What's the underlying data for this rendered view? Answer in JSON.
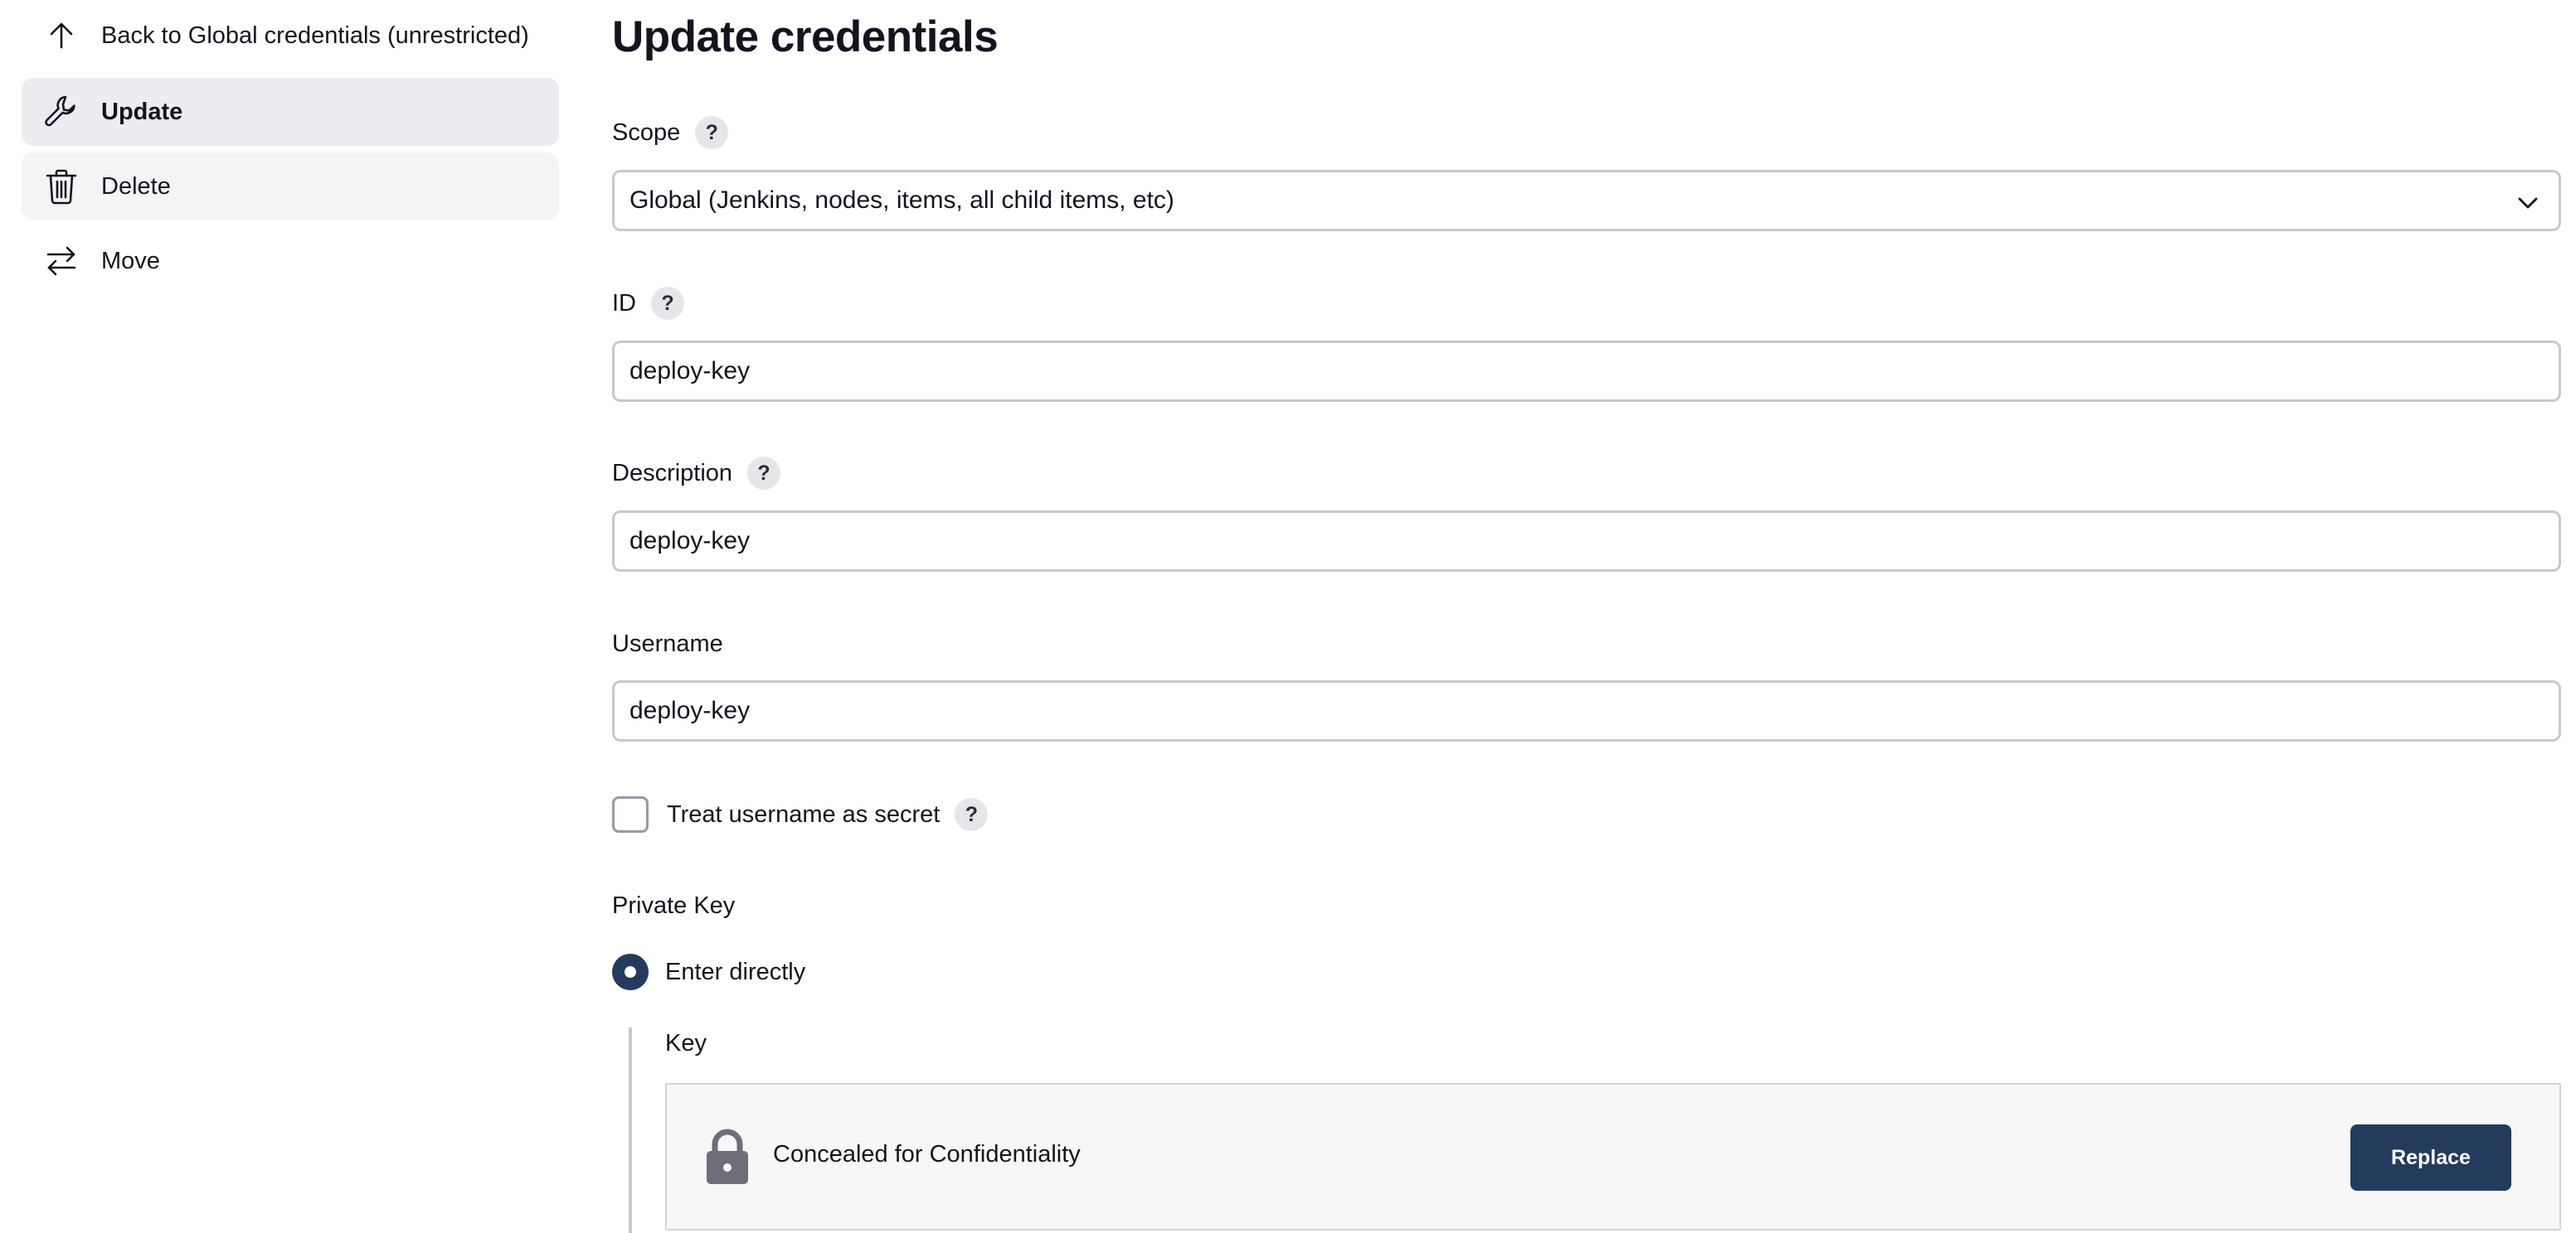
{
  "sidebar": {
    "items": [
      {
        "label": "Back to Global credentials (unrestricted)",
        "icon": "arrow-up-icon"
      },
      {
        "label": "Update",
        "icon": "wrench-icon"
      },
      {
        "label": "Delete",
        "icon": "trash-icon"
      },
      {
        "label": "Move",
        "icon": "swap-arrows-icon"
      }
    ]
  },
  "page": {
    "title": "Update credentials"
  },
  "form": {
    "scope": {
      "label": "Scope",
      "help": "?",
      "value": "Global (Jenkins, nodes, items, all child items, etc)"
    },
    "id": {
      "label": "ID",
      "help": "?",
      "value": "deploy-key"
    },
    "description": {
      "label": "Description",
      "help": "?",
      "value": "deploy-key"
    },
    "username": {
      "label": "Username",
      "value": "deploy-key"
    },
    "treat_secret": {
      "label": "Treat username as secret",
      "help": "?",
      "checked": false
    },
    "private_key": {
      "label": "Private Key",
      "option_label": "Enter directly",
      "selected": true,
      "key_label": "Key",
      "concealed_text": "Concealed for Confidentiality",
      "replace_label": "Replace"
    }
  },
  "colors": {
    "primary": "#233b5d",
    "selected_bg": "#ececf1",
    "hover_bg": "#f4f4f6",
    "input_border": "#c8c8d0"
  }
}
